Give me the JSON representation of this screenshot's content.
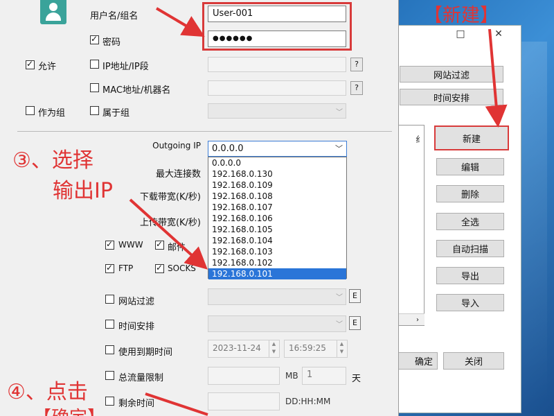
{
  "back_window": {
    "controls": [
      "□",
      "✕"
    ],
    "tabs": [
      "网站过滤",
      "时间安排"
    ],
    "side_buttons": [
      "新建",
      "编辑",
      "删除",
      "全选",
      "自动扫描",
      "导出",
      "导入"
    ],
    "pane_glyph": "纟",
    "pane_scroll": "›",
    "bottom_buttons": [
      "确定",
      "关闭"
    ],
    "bottom_partial": "确定"
  },
  "dialog": {
    "username_label": "用户名/组名",
    "username_value": "User-001",
    "password_label": "密码",
    "password_value": "●●●●●●",
    "allow_label": "允许",
    "ip_label": "IP地址/IP段",
    "mac_label": "MAC地址/机器名",
    "group_label": "作为组",
    "belong_label": "属于组",
    "help_glyph": "?",
    "outgoing_label": "Outgoing IP",
    "outgoing_value": "0.0.0.0",
    "max_conn_label": "最大连接数",
    "download_label": "下载带宽(K/秒)",
    "upload_label": "上传带宽(K/秒)",
    "dropdown_options": [
      "0.0.0.0",
      "192.168.0.130",
      "192.168.0.109",
      "192.168.0.108",
      "192.168.0.107",
      "192.168.0.106",
      "192.168.0.105",
      "192.168.0.104",
      "192.168.0.103",
      "192.168.0.102",
      "192.168.0.101"
    ],
    "selected_index": 10,
    "proto": {
      "www": "WWW",
      "mail": "邮件",
      "ftp": "FTP",
      "socks": "SOCKS"
    },
    "site_filter_label": "网站过滤",
    "schedule_label": "时间安排",
    "e_glyph": "E",
    "expire_label": "使用到期时间",
    "expire_date": "2023-11-24",
    "expire_time": "16:59:25",
    "traffic_label": "总流量限制",
    "traffic_unit": "MB",
    "traffic_days": "1",
    "traffic_days_unit": "天",
    "remain_label": "剩余时间",
    "remain_format": "DD:HH:MM"
  },
  "annotations": {
    "step3_line1": "③、选择",
    "step3_line2": "输出IP",
    "step4_line1": "④、点击",
    "step4_line2": "【确定】",
    "new_label": "【新建】"
  },
  "colors": {
    "annotation_red": "#d83a3a",
    "selection_blue": "#2a75d8",
    "avatar_teal": "#3aa39a"
  }
}
